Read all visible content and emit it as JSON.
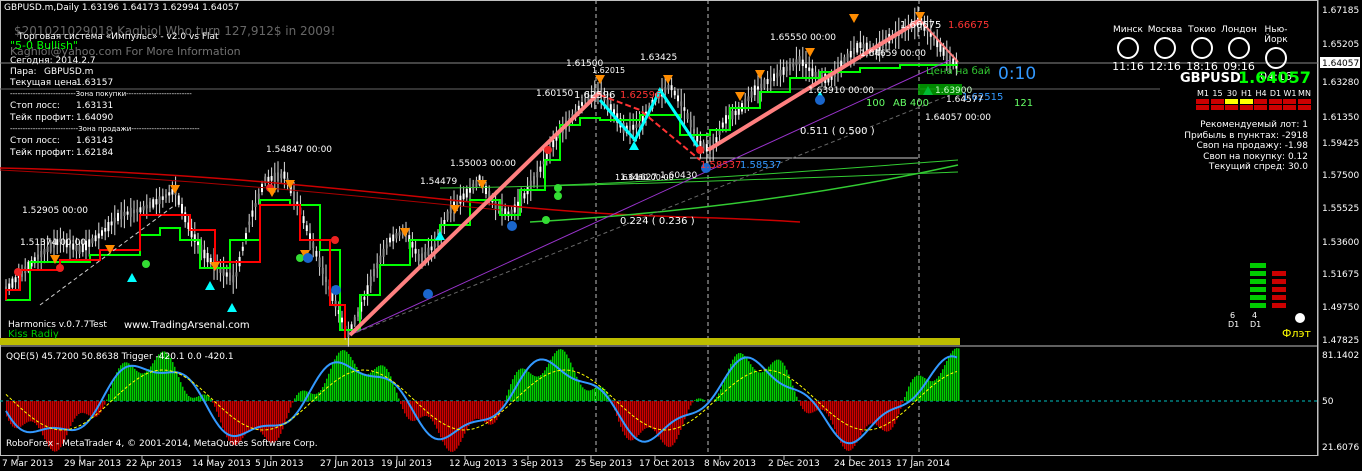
{
  "header": {
    "symbol_line": "GBPUSD.m,Daily  1.63196 1.64173 1.62994 1.64057"
  },
  "info_panel": {
    "line1": "Торговая система «Импульс» - v2.0 vs Flat",
    "line2": "\"5-0 Bullish\"",
    "line3": "Kaghiol@yahoo.com For More Information",
    "line4": "Сегодня:  2014.2.7",
    "pair_label": "Пара:",
    "pair_value": "GBPUSD.m",
    "price_label": "Текущая цена:",
    "price_value": "1.63157",
    "buy_zone": "--------------------------Зона покупки--------------------------",
    "buy_stop_label": "Стоп лосс:",
    "buy_stop_value": "1.63131",
    "buy_tp_label": "Тейк профит:",
    "buy_tp_value": "1.64090",
    "sell_zone": "---------------------------Зона продажи---------------------------",
    "sell_stop_label": "Стоп лосс:",
    "sell_stop_value": "1.63143",
    "sell_tp_label": "Тейк профит:",
    "sell_tp_value": "1.62184",
    "watermark": "$201021029018 Kaghiol Who turn 127,912$ in 2009!"
  },
  "clocks": [
    {
      "city": "Минск",
      "time": "11:16"
    },
    {
      "city": "Москва",
      "time": "12:16"
    },
    {
      "city": "Токио",
      "time": "18:16"
    },
    {
      "city": "Лондон",
      "time": "09:16"
    },
    {
      "city": "Нью-Йорк",
      "time": "04:16"
    }
  ],
  "right_panel": {
    "symbol": "GBPUSD",
    "price": "1.64057",
    "timeframes": [
      "M1",
      "15",
      "30",
      "H1",
      "H4",
      "D1",
      "W1",
      "MN"
    ],
    "lot_line": "Рекомендуемый лот: 1",
    "profit_line": "Прибыль в пунктах: -2918",
    "swap_sell_line": "Своп на продажу: -1.98",
    "swap_buy_line": "Своп на покупку: 0.12",
    "spread_line": "Текущий спред: 30.0",
    "d1_left": "6",
    "d1_left_tf": "D1",
    "d1_right": "4",
    "d1_right_tf": "D1",
    "flat": "Флэт",
    "countdown": "0:10"
  },
  "price_axis": {
    "labels": [
      "1.67185",
      "1.65205",
      "1.64057",
      "1.63280",
      "1.61350",
      "1.59425",
      "1.57500",
      "1.55525",
      "1.53600",
      "1.51675",
      "1.49750",
      "1.47825"
    ],
    "current": "1.64057"
  },
  "qqe_axis": {
    "labels": [
      "81.1402",
      "50",
      "21.6076"
    ]
  },
  "qqe_header": "QQE(5) 45.7200 50.8638   Trigger -420.1 0.0 -420.1",
  "footer": "RoboForex - MetaTrader 4, © 2001-2014, MetaQuotes Software Corp.",
  "bottom_left": "Harmonics v.0.7.7Test",
  "site": "www.TradingArsenal.com",
  "kiss": "Kiss Radiy",
  "date_axis": [
    "7 Mar 2013",
    "29 Mar 2013",
    "22 Apr 2013",
    "14 May 2013",
    "5 Jun 2013",
    "27 Jun 2013",
    "19 Jul 2013",
    "12 Aug 2013",
    "3 Sep 2013",
    "25 Sep 2013",
    "17 Oct 2013",
    "8 Nov 2013",
    "2 Dec 2013",
    "24 Dec 2013",
    "17 Jan 2014"
  ],
  "annotations": {
    "a1": "1.54847 00:00",
    "a2": "1.52905 00:00",
    "a3": "1.51374 00:00",
    "a4": "1.55003 00:00",
    "a5": "1.54479",
    "a6": "1.61500",
    "a7": "1.60150",
    "a8": "1.62596",
    "a8b": "1.62596",
    "a9": "1.63425",
    "a10": "1.61627",
    "a11": "1.60430",
    "a12": "1.58537",
    "a13": "1.58537",
    "a14": "0.511 ( 0.500 )",
    "a15": "0.224 ( 0.236 )",
    "a16": "1.66675",
    "a17": "1.66675",
    "a18": "1.63910 00:00",
    "a19": "1.64057 00:00",
    "a20": "1.62515",
    "a21": "100",
    "a22": "AB 400",
    "a23": "121",
    "a24": "Цена на бай",
    "a25": "1.63900",
    "a26": "1.64577",
    "a27": "1.63460 00:00",
    "a28": "1.62015",
    "a29": "1.64659 00:00",
    "a30": "1.65550 00:00"
  },
  "colors": {
    "bg": "#000000",
    "candle": "#ffffff",
    "green_line": "#00ff00",
    "red_line": "#ff0000",
    "salmon": "#ff8080",
    "cyan": "#00ffff",
    "orange": "#ff8c00",
    "blue_qqe": "#3399ff",
    "yellow": "#ffff00"
  }
}
